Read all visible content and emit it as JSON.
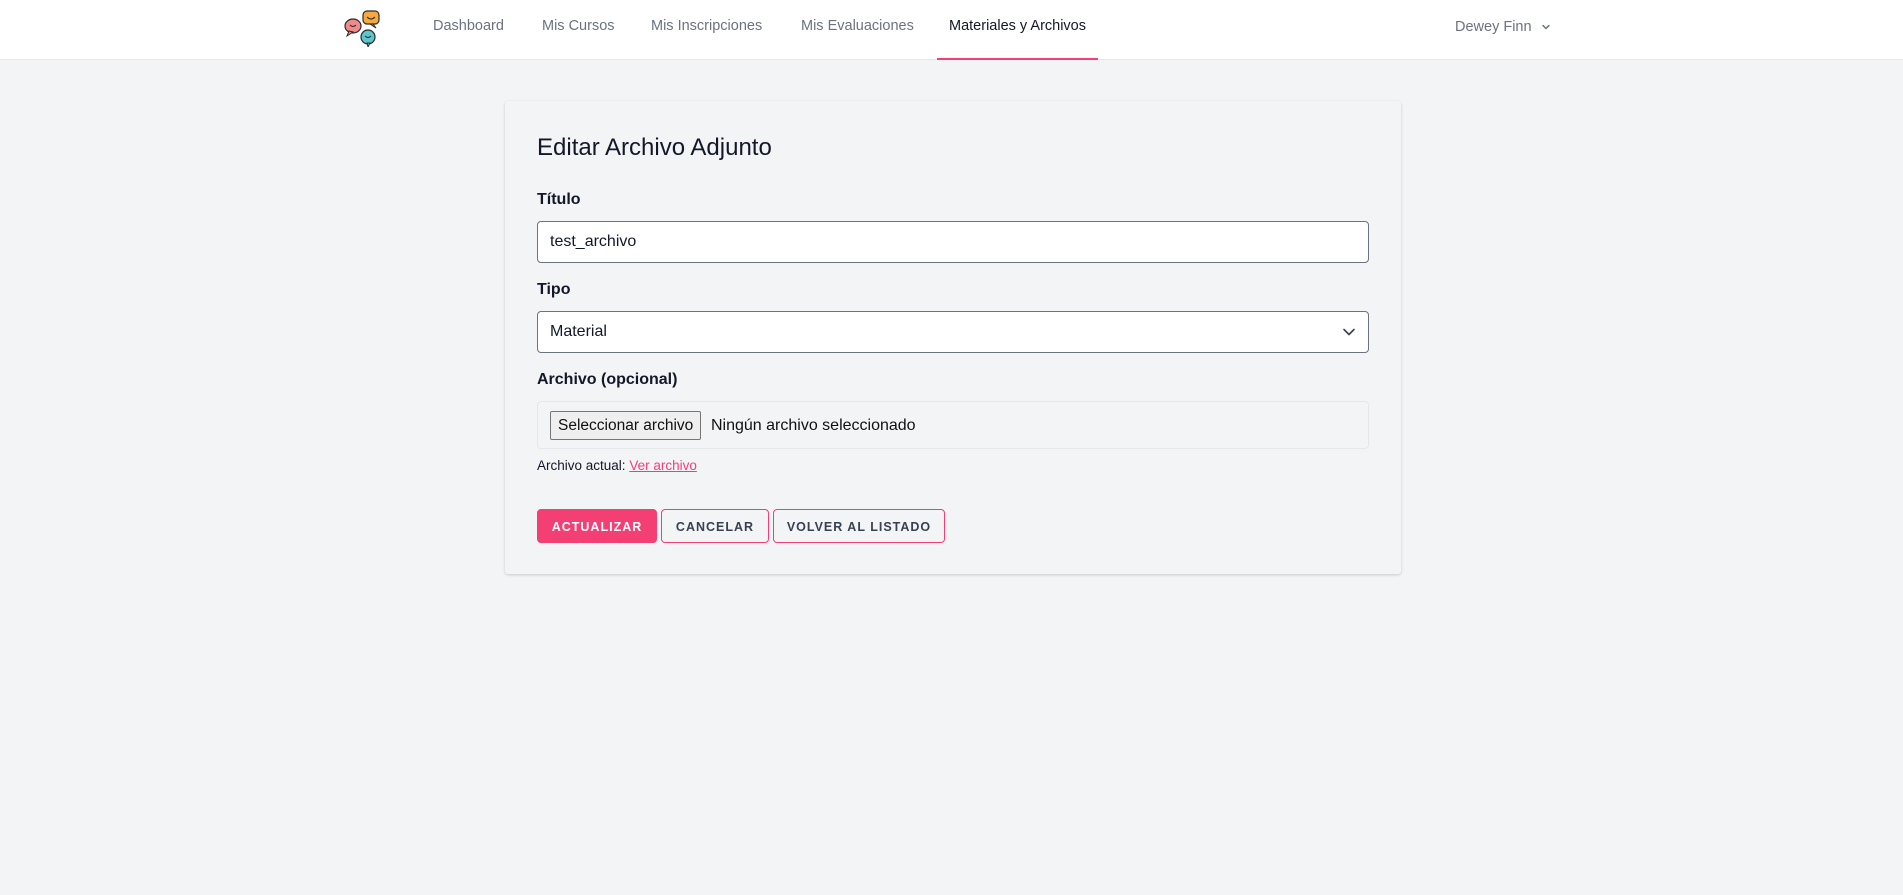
{
  "nav": {
    "links": [
      "Dashboard",
      "Mis Cursos",
      "Mis Inscripciones",
      "Mis Evaluaciones",
      "Materiales y Archivos"
    ],
    "active": "Materiales y Archivos",
    "user_name": "Dewey Finn",
    "logo_icon": "chat-bubbles-logo-icon"
  },
  "form": {
    "heading": "Editar Archivo Adjunto",
    "title_label": "Título",
    "title_value": "test_archivo",
    "type_label": "Tipo",
    "type_value": "Material",
    "file_label": "Archivo (opcional)",
    "file_button": "Seleccionar archivo",
    "file_status": "Ningún archivo seleccionado",
    "current_file_label": "Archivo actual:",
    "current_file_link": "Ver archivo"
  },
  "buttons": {
    "update": "ACTUALIZAR",
    "cancel": "CANCELAR",
    "back": "VOLVER AL LISTADO"
  },
  "colors": {
    "accent": "#f43f75",
    "page_bg": "#f3f4f6"
  }
}
